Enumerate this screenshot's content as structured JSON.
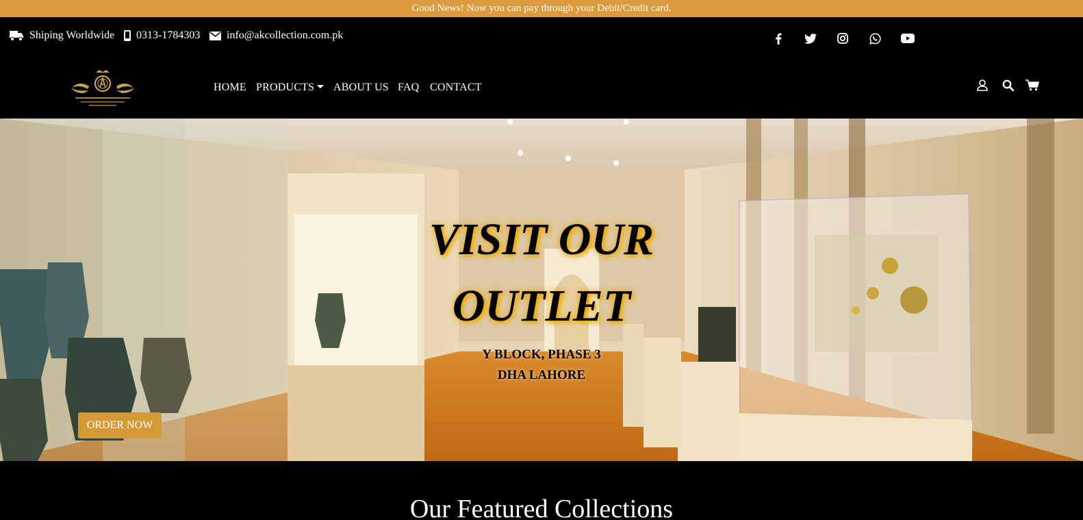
{
  "announcement": "Good News! Now you can pay through your Debit/Credit card.",
  "contact": {
    "shipping": "Shiping Worldwide",
    "phone": "0313-1784303",
    "email": "info@akcollection.com.pk"
  },
  "social_icons": [
    "facebook-icon",
    "twitter-icon",
    "instagram-icon",
    "whatsapp-icon",
    "youtube-icon"
  ],
  "nav": {
    "home": "HOME",
    "products": "PRODUCTS",
    "about": "ABOUT US",
    "faq": "FAQ",
    "contact": "CONTACT"
  },
  "hero": {
    "title_line1": "VISIT OUR",
    "title_line2": "OUTLET",
    "address_line1": "Y BLOCK, PHASE 3",
    "address_line2": "DHA LAHORE",
    "button": "ORDER NOW"
  },
  "featured_heading": "Our Featured Collections",
  "colors": {
    "accent": "#dc9a3f",
    "button": "#d59a36",
    "background": "#000000"
  }
}
